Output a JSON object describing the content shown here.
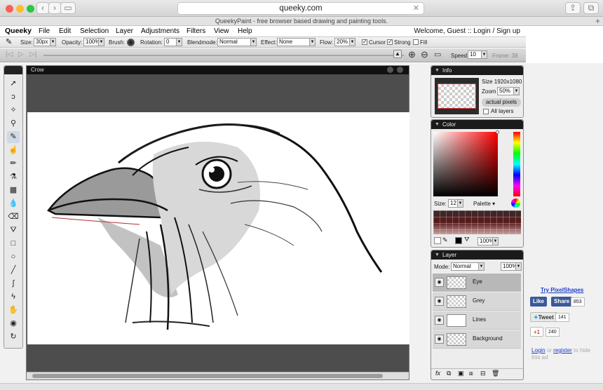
{
  "browser": {
    "url": "queeky.com",
    "page_title": "QueekyPaint - free browser based drawing and painting tools.",
    "back_icon": "chevron-left-icon",
    "forward_icon": "chevron-right-icon"
  },
  "menubar": {
    "brand": "Queeky",
    "items": [
      "File",
      "Edit",
      "Selection",
      "Layer",
      "Adjustments",
      "Filters",
      "View",
      "Help"
    ],
    "welcome": "Welcome, Guest ::",
    "login": "Login",
    "separator": "/",
    "signup": "Sign up"
  },
  "options": {
    "size_label": "Size:",
    "size_value": "30px",
    "opacity_label": "Opacity:",
    "opacity_value": "100%",
    "brush_label": "Brush:",
    "rotation_label": "Rotation:",
    "rotation_value": "0",
    "blendmode_label": "Blendmode:",
    "blendmode_value": "Normal",
    "effect_label": "Effect:",
    "effect_value": "None",
    "flow_label": "Flow:",
    "flow_value": "20%",
    "cursor_label": "Cursor",
    "cursor_checked": true,
    "strong_label": "Strong",
    "strong_checked": true,
    "fill_label": "Fill",
    "fill_checked": false
  },
  "animation": {
    "speed_label": "Speed:",
    "speed_value": "10",
    "frame_label": "Frame: 38"
  },
  "document": {
    "title": "Crow"
  },
  "info_panel": {
    "title": "Info",
    "size_text": "Size 1920x1080",
    "zoom_label": "Zoom",
    "zoom_value": "50%",
    "actual_pixels": "actual pixels",
    "all_layers": "All layers"
  },
  "color_panel": {
    "title": "Color",
    "size_label": "Size:",
    "size_value": "12",
    "palette_label": "Palette",
    "opacity_value": "100%",
    "accent": "#ff0000"
  },
  "layer_panel": {
    "title": "Layer",
    "mode_label": "Mode:",
    "mode_value": "Normal",
    "opacity_value": "100%",
    "layers": [
      {
        "name": "Eye"
      },
      {
        "name": "Grey"
      },
      {
        "name": "Lines"
      },
      {
        "name": "Background"
      }
    ]
  },
  "ad": {
    "try_link": "Try PixelShapes",
    "fb_like": "Like",
    "fb_share": "Share",
    "fb_count": "853",
    "tweet": "Tweet",
    "tweet_count": "141",
    "gplus": "+1",
    "gplus_count": "240",
    "login": "Login",
    "or": "or",
    "register": "register",
    "hide_text": "to hide this ad"
  }
}
